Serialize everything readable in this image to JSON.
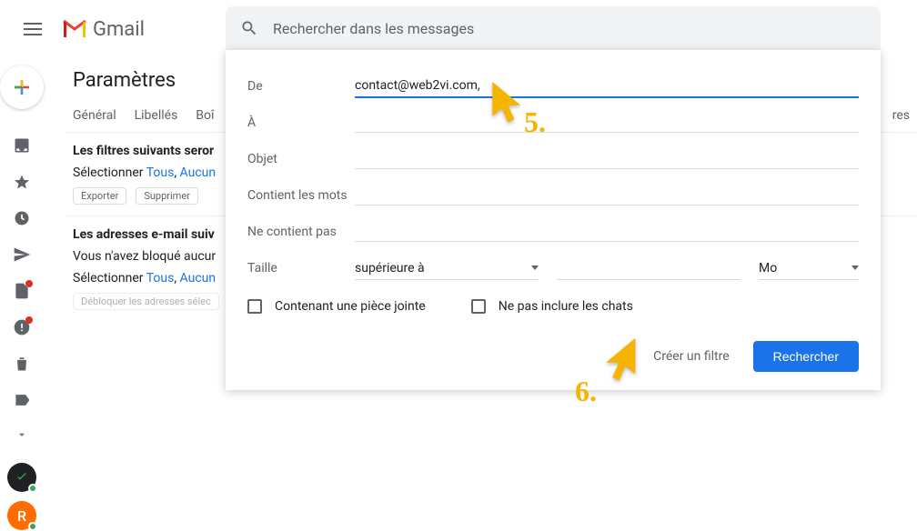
{
  "header": {
    "brand": "Gmail",
    "search_placeholder": "Rechercher dans les messages"
  },
  "page": {
    "title": "Paramètres",
    "tabs": [
      "Général",
      "Libellés",
      "Boî",
      "res"
    ]
  },
  "filters": {
    "heading": "Les filtres suivants seror",
    "select_label": "Sélectionner",
    "select_all": "Tous",
    "select_none": "Aucun",
    "action_export": "Exporter",
    "action_delete": "Supprimer"
  },
  "blocked": {
    "heading": "Les adresses e-mail suiv",
    "empty_text": "Vous n'avez bloqué aucur",
    "select_label": "Sélectionner",
    "select_all": "Tous",
    "select_none": "Aucun",
    "action_unblock": "Débloquer les adresses sélec"
  },
  "filter_form": {
    "from_label": "De",
    "from_value": "contact@web2vi.com,",
    "to_label": "À",
    "subject_label": "Objet",
    "has_words_label": "Contient les mots",
    "not_words_label": "Ne contient pas",
    "size_label": "Taille",
    "size_op": "supérieure à",
    "size_unit": "Mo",
    "has_attachment": "Contenant une pièce jointe",
    "exclude_chats": "Ne pas inclure les chats",
    "create_filter": "Créer un filtre",
    "search": "Rechercher"
  },
  "contacts": {
    "avatar_letter": "R"
  },
  "annotations": {
    "a5": "5.",
    "a6": "6."
  }
}
